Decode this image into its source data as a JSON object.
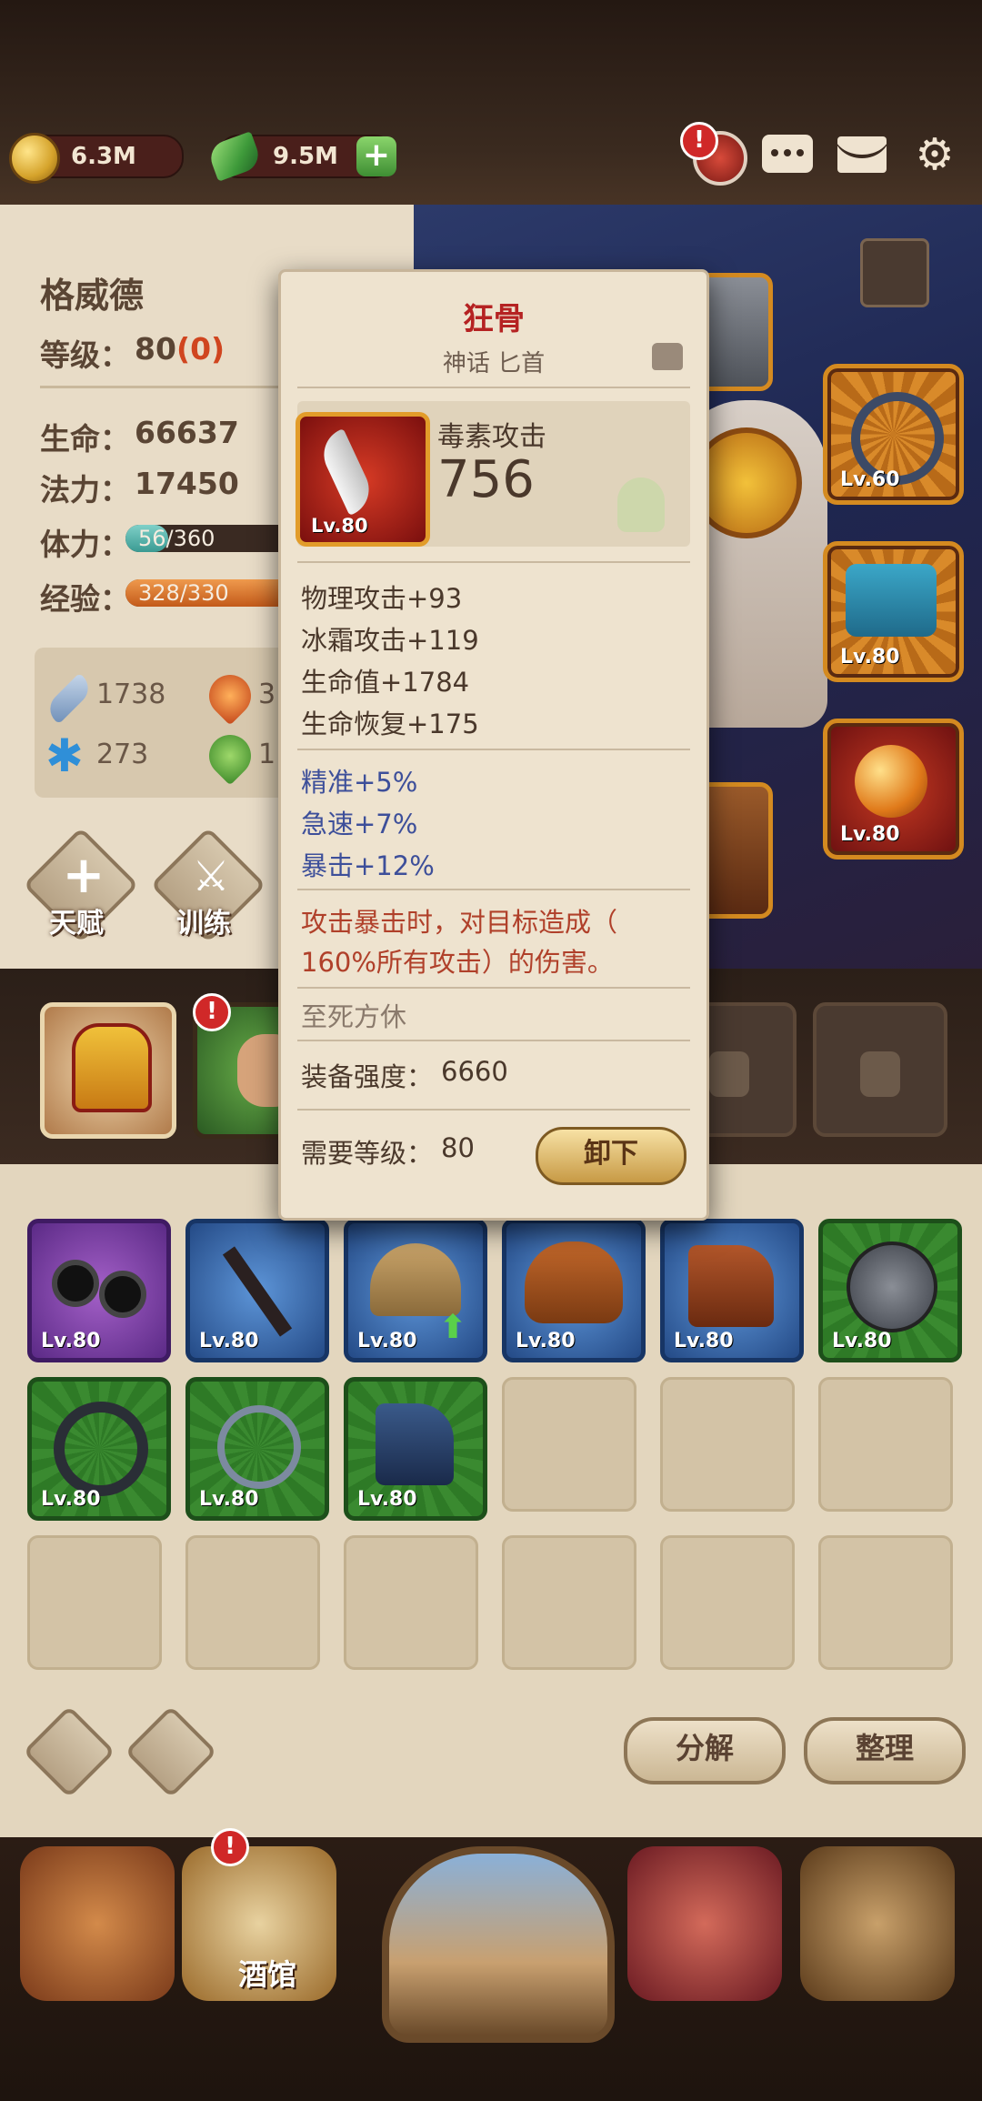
{
  "resources": {
    "gold": "6.3M",
    "gems": "9.5M"
  },
  "top_icons": [
    "helmet-icon",
    "chat-icon",
    "mail-icon",
    "gear-icon"
  ],
  "hero": {
    "name": "格威德",
    "level_label": "等级：",
    "level": "80",
    "level_bonus": "(0)",
    "hp_label": "生命：",
    "hp": "66637",
    "mana_label": "法力：",
    "mana": "17450",
    "stamina_label": "体力：",
    "stamina_text": "56/360",
    "stamina_fraction": 0.156,
    "exp_label": "经验：",
    "exp_text": "328/330",
    "exp_fraction": 0.994,
    "stats": [
      {
        "icon": "sword-icon",
        "value": "1738"
      },
      {
        "icon": "fire-icon",
        "value": "3"
      },
      {
        "icon": "snowflake-icon",
        "value": "273"
      },
      {
        "icon": "poison-icon",
        "value": "1"
      }
    ],
    "talent_label": "天赋",
    "train_label": "训练"
  },
  "equip_slots": [
    {
      "level": "Lv.60",
      "icon": "ring-icon"
    },
    {
      "level": "Lv.80",
      "icon": "cloak-icon"
    },
    {
      "level": "Lv.80",
      "icon": "orb-icon"
    }
  ],
  "tooltip": {
    "name": "狂骨",
    "type": "神话 匕首",
    "item_level": "Lv.80",
    "main_stat_label": "毒素攻击",
    "main_stat_value": "756",
    "base_stats": [
      "物理攻击+93",
      "冰霜攻击+119",
      "生命值+1784",
      "生命恢复+175"
    ],
    "bonus_stats": [
      "精准+5%",
      "急速+7%",
      "暴击+12%"
    ],
    "effect": [
      "攻击暴击时，对目标造成（",
      "160%所有攻击）的伤害。"
    ],
    "set_name": "至死方休",
    "power_label": "装备强度：",
    "power": "6660",
    "req_label": "需要等级：",
    "req_level": "80",
    "unequip_label": "卸下"
  },
  "inventory": [
    {
      "rarity": "purple",
      "level": "Lv.80",
      "icon": "goggles-icon"
    },
    {
      "rarity": "blue",
      "level": "Lv.80",
      "icon": "staff-icon"
    },
    {
      "rarity": "blue",
      "level": "Lv.80",
      "icon": "helmet-icon"
    },
    {
      "rarity": "blue",
      "level": "Lv.80",
      "icon": "leather-helmet-icon"
    },
    {
      "rarity": "blue",
      "level": "Lv.80",
      "icon": "boots-icon"
    },
    {
      "rarity": "green",
      "level": "Lv.80",
      "icon": "shield-icon"
    },
    {
      "rarity": "green",
      "level": "Lv.80",
      "icon": "ring-icon"
    },
    {
      "rarity": "green",
      "level": "Lv.80",
      "icon": "ring-icon"
    },
    {
      "rarity": "green",
      "level": "Lv.80",
      "icon": "boots-icon"
    }
  ],
  "inventory_buttons": {
    "salvage": "分解",
    "sort": "整理"
  },
  "nav": {
    "tavern_label": "酒馆"
  }
}
